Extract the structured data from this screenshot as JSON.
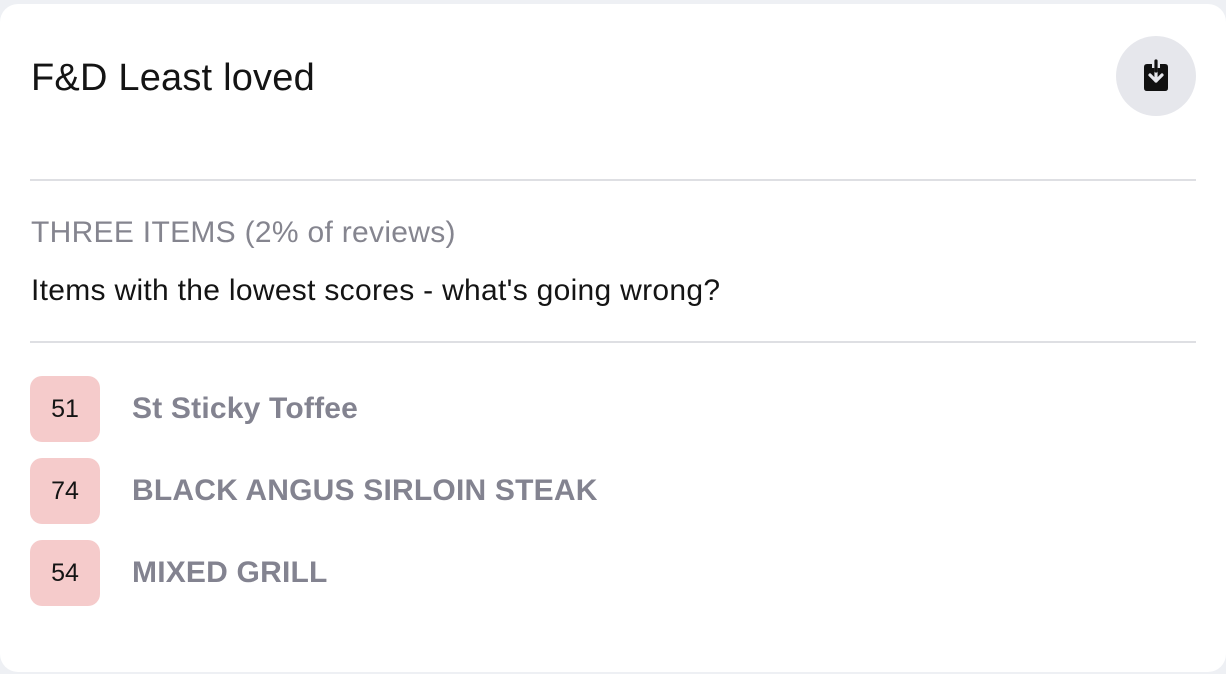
{
  "card": {
    "title": "F&D Least loved",
    "download_icon": "download-icon"
  },
  "section": {
    "label": "THREE ITEMS (2% of reviews)",
    "description": "Items with the lowest scores - what's going wrong?"
  },
  "items": [
    {
      "score": "51",
      "name": "St Sticky Toffee"
    },
    {
      "score": "74",
      "name": "BLACK ANGUS SIRLOIN STEAK"
    },
    {
      "score": "54",
      "name": "MIXED GRILL"
    }
  ],
  "colors": {
    "score_badge_bg": "#f5cbcb",
    "item_name": "#838390",
    "muted_label": "#85858f",
    "download_button_bg": "#e6e7ec"
  }
}
